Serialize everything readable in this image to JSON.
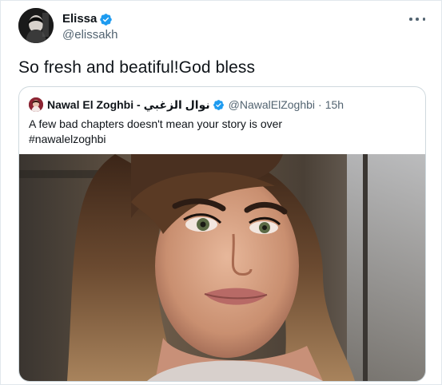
{
  "tweet": {
    "author": {
      "display_name": "Elissa",
      "handle": "@elissakh",
      "avatar_icon": "profile-photo-icon"
    },
    "text": "So fresh and beatiful!God bless",
    "more_icon": "more-options-icon",
    "colors": {
      "verified": "#1d9bf0",
      "secondary_text": "#536471",
      "border": "#cfd9de"
    }
  },
  "quoted_tweet": {
    "display_name": "Nawal El Zoghbi - نوال الزغبي",
    "handle": "@NawalElZoghbi",
    "separator": "·",
    "time": "15h",
    "text_line1": "A few bad chapters doesn't mean your story is over",
    "text_line2": "#nawalelzoghbi",
    "image_icon": "selfie-photo"
  }
}
